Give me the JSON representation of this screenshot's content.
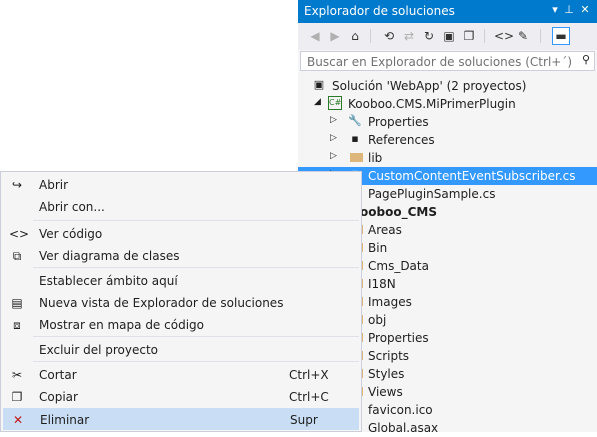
{
  "panel": {
    "title": "Explorador de soluciones",
    "controls": {
      "dropdown": "▾",
      "pin": "⊥",
      "close": "✕"
    },
    "toolbar": [
      {
        "name": "back-icon",
        "glyph": "◀",
        "state": "dim"
      },
      {
        "name": "forward-icon",
        "glyph": "▶",
        "state": "dim"
      },
      {
        "name": "home-icon",
        "glyph": "⌂",
        "state": "normal"
      },
      {
        "name": "pending-changes-filter-icon",
        "glyph": "⟲",
        "state": "normal"
      },
      {
        "name": "sync-icon",
        "glyph": "⇄",
        "state": "dim"
      },
      {
        "name": "refresh-icon",
        "glyph": "↻",
        "state": "normal"
      },
      {
        "name": "collapse-all-icon",
        "glyph": "▣",
        "state": "normal"
      },
      {
        "name": "show-all-files-icon",
        "glyph": "❐",
        "state": "normal"
      },
      {
        "name": "view-code-icon",
        "glyph": "<>",
        "state": "normal"
      },
      {
        "name": "properties-wrench-icon",
        "glyph": "✎",
        "state": "normal"
      },
      {
        "name": "preview-selected-items-icon",
        "glyph": "▬",
        "state": "active"
      }
    ],
    "search": {
      "placeholder": "Buscar en Explorador de soluciones (Ctrl+´)",
      "value": "",
      "icon": "search-icon"
    }
  },
  "tree": [
    {
      "label": "Solución 'WebApp'  (2 proyectos)",
      "icon": "solution-icon",
      "glyph": "▣",
      "expander": ""
    },
    {
      "label": "Kooboo.CMS.MiPrimerPlugin",
      "icon": "csharp-project-icon",
      "glyph": "C#",
      "expander": "◢"
    },
    {
      "label": "Properties",
      "icon": "wrench-icon",
      "glyph": "🔧",
      "expander": "▷"
    },
    {
      "label": "References",
      "icon": "references-icon",
      "glyph": "▪",
      "expander": "▷"
    },
    {
      "label": "lib",
      "icon": "folder-icon",
      "glyph": "",
      "expander": "▷"
    },
    {
      "label": "CustomContentEventSubscriber.cs",
      "icon": "csharp-file-icon",
      "glyph": "▢",
      "expander": "▷",
      "selected": true
    },
    {
      "label": "PagePluginSample.cs",
      "icon": "csharp-file-icon",
      "glyph": "▢",
      "expander": ""
    },
    {
      "label": "ooboo_CMS",
      "icon": "web-project-icon",
      "glyph": "",
      "expander": "",
      "bold": true
    },
    {
      "label": "Areas",
      "icon": "folder-icon",
      "glyph": "",
      "expander": ""
    },
    {
      "label": "Bin",
      "icon": "folder-icon",
      "glyph": "",
      "expander": ""
    },
    {
      "label": "Cms_Data",
      "icon": "folder-icon",
      "glyph": "",
      "expander": ""
    },
    {
      "label": "I18N",
      "icon": "folder-icon",
      "glyph": "",
      "expander": ""
    },
    {
      "label": "Images",
      "icon": "folder-icon",
      "glyph": "",
      "expander": ""
    },
    {
      "label": "obj",
      "icon": "folder-icon",
      "glyph": "",
      "expander": ""
    },
    {
      "label": "Properties",
      "icon": "folder-icon",
      "glyph": "",
      "expander": ""
    },
    {
      "label": "Scripts",
      "icon": "folder-icon",
      "glyph": "",
      "expander": ""
    },
    {
      "label": "Styles",
      "icon": "folder-icon",
      "glyph": "",
      "expander": ""
    },
    {
      "label": "Views",
      "icon": "folder-icon",
      "glyph": "",
      "expander": ""
    },
    {
      "label": "favicon.ico",
      "icon": "file-icon",
      "glyph": "",
      "expander": ""
    },
    {
      "label": "Global.asax",
      "icon": "file-icon",
      "glyph": "",
      "expander": ""
    }
  ],
  "menu": {
    "groups": [
      [
        {
          "label": "Abrir",
          "icon": "open-arrow-icon",
          "glyph": "↪",
          "key": ""
        },
        {
          "label": "Abrir con...",
          "icon": "",
          "glyph": "",
          "key": ""
        }
      ],
      [
        {
          "label": "Ver código",
          "icon": "view-code-icon",
          "glyph": "<>",
          "key": ""
        },
        {
          "label": "Ver diagrama de clases",
          "icon": "class-diagram-icon",
          "glyph": "⧉",
          "key": ""
        }
      ],
      [
        {
          "label": "Establecer ámbito aquí",
          "icon": "",
          "glyph": "",
          "key": ""
        },
        {
          "label": "Nueva vista de Explorador de soluciones",
          "icon": "new-view-icon",
          "glyph": "▤",
          "key": ""
        },
        {
          "label": "Mostrar en mapa de código",
          "icon": "code-map-icon",
          "glyph": "⧈",
          "key": ""
        }
      ],
      [
        {
          "label": "Excluir del proyecto",
          "icon": "",
          "glyph": "",
          "key": ""
        }
      ],
      [
        {
          "label": "Cortar",
          "icon": "scissors-icon",
          "glyph": "✂",
          "key": "Ctrl+X"
        },
        {
          "label": "Copiar",
          "icon": "copy-icon",
          "glyph": "❐",
          "key": "Ctrl+C"
        },
        {
          "label": "Eliminar",
          "icon": "delete-x-icon",
          "glyph": "✕",
          "key": "Supr",
          "highlighted": true
        }
      ]
    ]
  },
  "colors": {
    "accent": "#007acc",
    "selection": "#3399ff",
    "menu_highlight": "#c9def5",
    "delete_red": "#c21818"
  }
}
